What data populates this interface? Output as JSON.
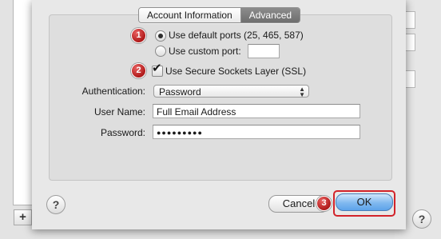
{
  "tabs": [
    {
      "label": "Account Information",
      "selected": false
    },
    {
      "label": "Advanced",
      "selected": true
    }
  ],
  "steps": [
    "1",
    "2",
    "3"
  ],
  "ports": {
    "default_label": "Use default ports (25, 465, 587)",
    "default_selected": true,
    "custom_label": "Use custom port:",
    "custom_value": ""
  },
  "ssl": {
    "label": "Use Secure Sockets Layer (SSL)",
    "checked": true
  },
  "authentication": {
    "label": "Authentication:",
    "value": "Password"
  },
  "user_name": {
    "label": "User Name:",
    "value": "Full Email Address"
  },
  "password": {
    "label": "Password:",
    "value": "●●●●●●●●●"
  },
  "buttons": {
    "help": "?",
    "cancel": "Cancel",
    "ok": "OK"
  },
  "background": {
    "add": "+",
    "help": "?"
  },
  "colors": {
    "badge": "#c0282c",
    "highlight": "#d2232a",
    "default_button": "#6aaef0"
  }
}
